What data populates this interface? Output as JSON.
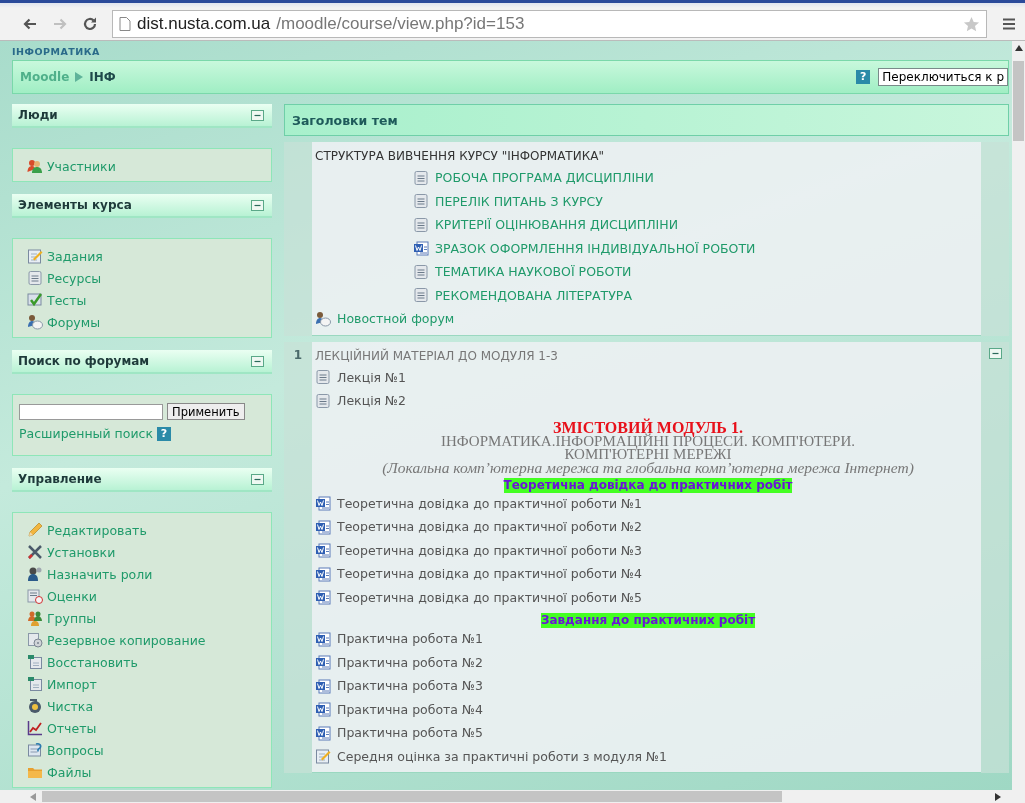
{
  "browser": {
    "url_host": "dist.nusta.com.ua",
    "url_path": "/moodle/course/view.php?id=153",
    "back_disabled": false,
    "forward_disabled": true
  },
  "header": {
    "site_title": "ІНФОРМАТИКА",
    "breadcrumb": [
      "Moodle",
      "ІНФ"
    ],
    "help": "?",
    "switch_role": "Переключиться к р"
  },
  "sidebar": [
    {
      "title": "Люди",
      "kind": "links",
      "items": [
        {
          "label": "Участники",
          "kind": "people"
        }
      ]
    },
    {
      "title": "Элементы курса",
      "kind": "links",
      "items": [
        {
          "label": "Задания",
          "kind": "assignment"
        },
        {
          "label": "Ресурсы",
          "kind": "doc"
        },
        {
          "label": "Тесты",
          "kind": "quiz"
        },
        {
          "label": "Форумы",
          "kind": "forum"
        }
      ]
    },
    {
      "title": "Поиск по форумам",
      "kind": "search",
      "button": "Применить",
      "advanced": "Расширенный поиск",
      "help": "?"
    },
    {
      "title": "Управление",
      "kind": "links",
      "items": [
        {
          "label": "Редактировать",
          "kind": "pencil"
        },
        {
          "label": "Установки",
          "kind": "tools"
        },
        {
          "label": "Назначить роли",
          "kind": "roles"
        },
        {
          "label": "Оценки",
          "kind": "grades"
        },
        {
          "label": "Группы",
          "kind": "groups"
        },
        {
          "label": "Резервное копирование",
          "kind": "backup"
        },
        {
          "label": "Восстановить",
          "kind": "restore"
        },
        {
          "label": "Импорт",
          "kind": "restore"
        },
        {
          "label": "Чистка",
          "kind": "cleanup"
        },
        {
          "label": "Отчеты",
          "kind": "reports"
        },
        {
          "label": "Вопросы",
          "kind": "questions"
        },
        {
          "label": "Файлы",
          "kind": "folder"
        }
      ]
    }
  ],
  "main": {
    "title": "Заголовки тем",
    "sections": [
      {
        "title": "СТРУКТУРА ВИВЧЕННЯ КУРСУ \"ІНФОРМАТИКА\"",
        "dimmed": false,
        "collapsible": false,
        "items": [
          {
            "kind": "group",
            "children": [
              {
                "kind": "doc",
                "label": "РОБОЧА ПРОГРАМА ДИСЦИПЛІНИ",
                "dimmed": false
              },
              {
                "kind": "doc",
                "label": "ПЕРЕЛІК ПИТАНЬ З КУРСУ",
                "dimmed": false
              },
              {
                "kind": "doc",
                "label": "КРИТЕРІЇ ОЦІНЮВАННЯ ДИСЦИПЛІНИ",
                "dimmed": false
              },
              {
                "kind": "word",
                "label": "ЗРАЗОК ОФОРМЛЕННЯ ІНДИВІДУАЛЬНОЇ РОБОТИ",
                "dimmed": false
              },
              {
                "kind": "doc",
                "label": "ТЕМАТИКА НАУКОВОЇ РОБОТИ",
                "dimmed": false
              },
              {
                "kind": "doc",
                "label": "РЕКОМЕНДОВАНА ЛІТЕРАТУРА",
                "dimmed": false
              }
            ]
          },
          {
            "kind": "forum",
            "label": "Новостной форум",
            "dimmed": false
          }
        ]
      },
      {
        "number": "1",
        "title": "ЛЕКЦІЙНИЙ МАТЕРІАЛ ДО МОДУЛЯ 1-3",
        "dimmed": true,
        "collapsible": true,
        "items": [
          {
            "kind": "doc",
            "label": "Лекція №1",
            "dimmed": true
          },
          {
            "kind": "doc",
            "label": "Лекція №2",
            "dimmed": true
          },
          {
            "kind": "banner",
            "title": "ЗМІСТОВИЙ МОДУЛЬ 1.",
            "subtitle": "ІНФОРМАТИКА.ІНФОРМАЦІЙНІ ПРОЦЕСИ. КОМП'ЮТЕРИ. КОМП'ЮТЕРНІ МЕРЕЖІ",
            "note": "(Локальна комп’ютерна мережа та глобальна комп’ютерна мережа Інтернет)"
          },
          {
            "kind": "label",
            "label": "Теоретична довідка до практичних робіт"
          },
          {
            "kind": "word",
            "label": "Теоретична довідка до практичної роботи №1",
            "dimmed": true
          },
          {
            "kind": "word",
            "label": "Теоретична довідка до практичної роботи №2",
            "dimmed": true
          },
          {
            "kind": "word",
            "label": "Теоретична довідка до практичної роботи №3",
            "dimmed": true
          },
          {
            "kind": "word",
            "label": "Теоретична довідка до практичної роботи №4",
            "dimmed": true
          },
          {
            "kind": "word",
            "label": "Теоретична довідка до практичної роботи №5",
            "dimmed": true
          },
          {
            "kind": "label",
            "label": "Завдання до практичних робіт"
          },
          {
            "kind": "word",
            "label": "Практична робота №1",
            "dimmed": true
          },
          {
            "kind": "word",
            "label": "Практична робота №2",
            "dimmed": true
          },
          {
            "kind": "word",
            "label": "Практична робота №3",
            "dimmed": true
          },
          {
            "kind": "word",
            "label": "Практична робота №4",
            "dimmed": true
          },
          {
            "kind": "word",
            "label": "Практична робота №5",
            "dimmed": true
          },
          {
            "kind": "assignment",
            "label": "Середня оцінка за практичні роботи з модуля №1",
            "dimmed": true
          }
        ]
      }
    ]
  }
}
